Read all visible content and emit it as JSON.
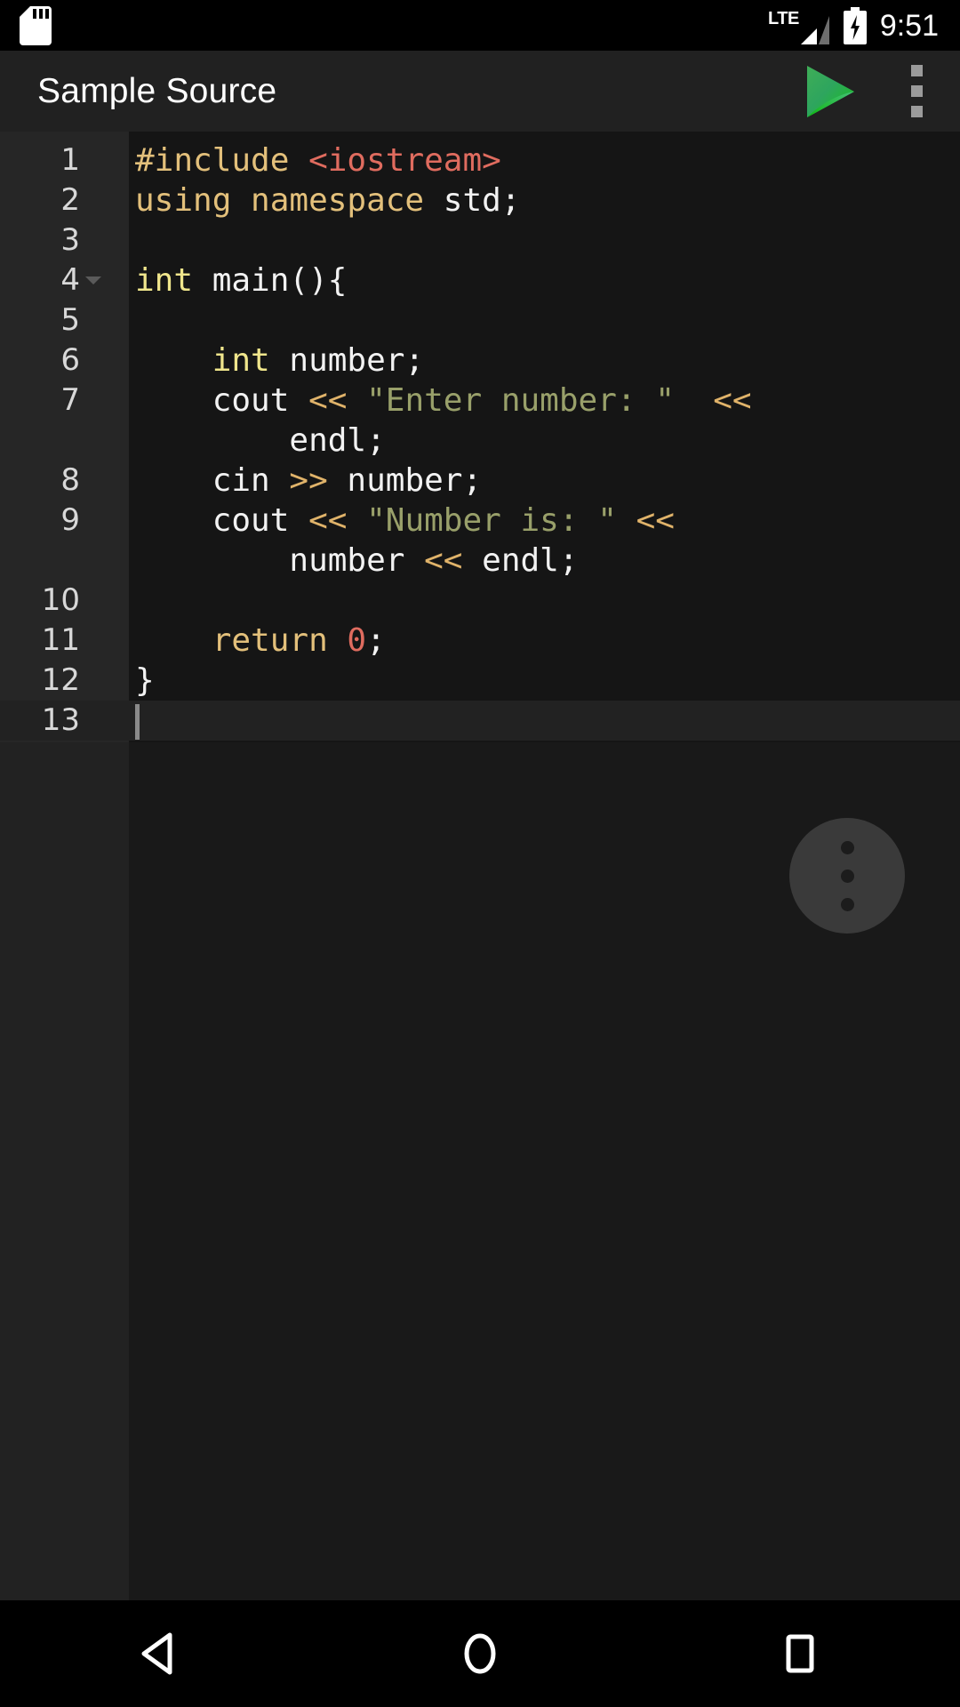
{
  "status_bar": {
    "sd_icon": "sd-card-icon",
    "network_label": "LTE",
    "signal_icon": "signal-bars-icon",
    "battery_icon": "battery-charging-icon",
    "time": "9:51"
  },
  "app_bar": {
    "title": "Sample Source",
    "run_icon": "play-icon",
    "overflow_icon": "overflow-menu-icon",
    "background": "#212121"
  },
  "editor": {
    "gutter_background": "#262626",
    "code_background": "#151515",
    "current_line_background": "#222222",
    "cursor_line": 13,
    "fold_marker_line": 4,
    "lines": [
      {
        "number": "1",
        "tokens": [
          {
            "text": "#include ",
            "cls": "t-pre"
          },
          {
            "text": "<iostream>",
            "cls": "t-inc"
          }
        ]
      },
      {
        "number": "2",
        "tokens": [
          {
            "text": "using namespace ",
            "cls": "t-kw"
          },
          {
            "text": "std;",
            "cls": "t-pln"
          }
        ]
      },
      {
        "number": "3",
        "tokens": []
      },
      {
        "number": "4",
        "fold": true,
        "tokens": [
          {
            "text": "int ",
            "cls": "t-type"
          },
          {
            "text": "main(){",
            "cls": "t-pln"
          }
        ]
      },
      {
        "number": "5",
        "tokens": []
      },
      {
        "number": "6",
        "tokens": [
          {
            "text": "    ",
            "cls": "t-pln"
          },
          {
            "text": "int ",
            "cls": "t-type"
          },
          {
            "text": "number;",
            "cls": "t-pln"
          }
        ]
      },
      {
        "number": "7",
        "tokens": [
          {
            "text": "    cout ",
            "cls": "t-pln"
          },
          {
            "text": "<< ",
            "cls": "t-op"
          },
          {
            "text": "\"Enter number: \"",
            "cls": "t-str"
          },
          {
            "text": "  ",
            "cls": "t-pln"
          },
          {
            "text": "<<",
            "cls": "t-op"
          }
        ]
      },
      {
        "number": "",
        "wrapped": true,
        "tokens": [
          {
            "text": "        endl;",
            "cls": "t-pln"
          }
        ]
      },
      {
        "number": "8",
        "tokens": [
          {
            "text": "    cin ",
            "cls": "t-pln"
          },
          {
            "text": ">> ",
            "cls": "t-op"
          },
          {
            "text": "number;",
            "cls": "t-pln"
          }
        ]
      },
      {
        "number": "9",
        "tokens": [
          {
            "text": "    cout ",
            "cls": "t-pln"
          },
          {
            "text": "<< ",
            "cls": "t-op"
          },
          {
            "text": "\"Number is: \"",
            "cls": "t-str"
          },
          {
            "text": " ",
            "cls": "t-pln"
          },
          {
            "text": "<<",
            "cls": "t-op"
          }
        ]
      },
      {
        "number": "",
        "wrapped": true,
        "tokens": [
          {
            "text": "        number ",
            "cls": "t-pln"
          },
          {
            "text": "<< ",
            "cls": "t-op"
          },
          {
            "text": "endl;",
            "cls": "t-pln"
          }
        ]
      },
      {
        "number": "10",
        "tokens": []
      },
      {
        "number": "11",
        "tokens": [
          {
            "text": "    ",
            "cls": "t-pln"
          },
          {
            "text": "return ",
            "cls": "t-kw"
          },
          {
            "text": "0",
            "cls": "t-num"
          },
          {
            "text": ";",
            "cls": "t-pln"
          }
        ]
      },
      {
        "number": "12",
        "tokens": [
          {
            "text": "}",
            "cls": "t-pln"
          }
        ]
      },
      {
        "number": "13",
        "current": true,
        "tokens": []
      }
    ]
  },
  "fab": {
    "icon": "more-options-icon",
    "background": "#3a3a3a"
  },
  "nav_bar": {
    "back_icon": "back-triangle-icon",
    "home_icon": "home-circle-icon",
    "recents_icon": "recents-square-icon"
  }
}
